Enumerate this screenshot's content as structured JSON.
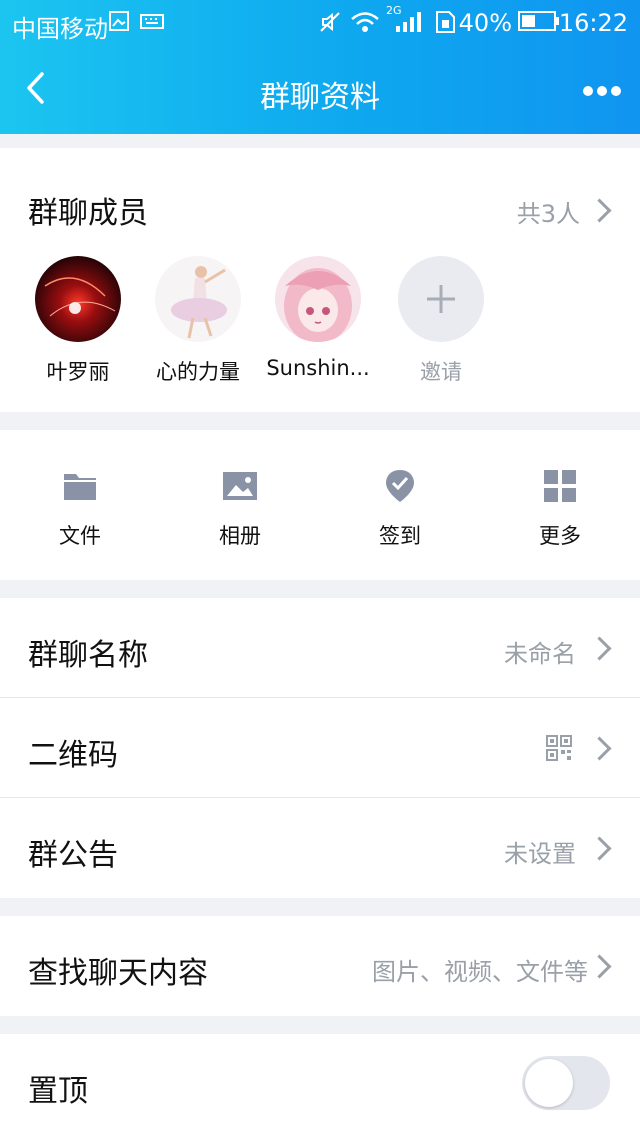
{
  "status_bar": {
    "carrier": "中国移动",
    "network": "2G",
    "battery": "40%",
    "time": "16:22"
  },
  "header": {
    "title": "群聊资料"
  },
  "members": {
    "heading": "群聊成员",
    "count": "共3人",
    "items": [
      {
        "name": "叶罗丽"
      },
      {
        "name": "心的力量"
      },
      {
        "name": "Sunshin..."
      }
    ],
    "invite_label": "邀请"
  },
  "tools": [
    {
      "label": "文件",
      "icon": "folder-icon"
    },
    {
      "label": "相册",
      "icon": "image-icon"
    },
    {
      "label": "签到",
      "icon": "checkin-icon"
    },
    {
      "label": "更多",
      "icon": "grid-icon"
    }
  ],
  "settings": {
    "group_name": {
      "label": "群聊名称",
      "value": "未命名"
    },
    "qr_code": {
      "label": "二维码"
    },
    "announcement": {
      "label": "群公告",
      "value": "未设置"
    },
    "search_chat": {
      "label": "查找聊天内容",
      "value": "图片、视频、文件等"
    },
    "pin_top": {
      "label": "置顶",
      "enabled": false
    }
  },
  "colors": {
    "header_start": "#1cc5f0",
    "header_end": "#1095f0",
    "icon_gray": "#8a92a6",
    "secondary_text": "#9aa0a8"
  }
}
